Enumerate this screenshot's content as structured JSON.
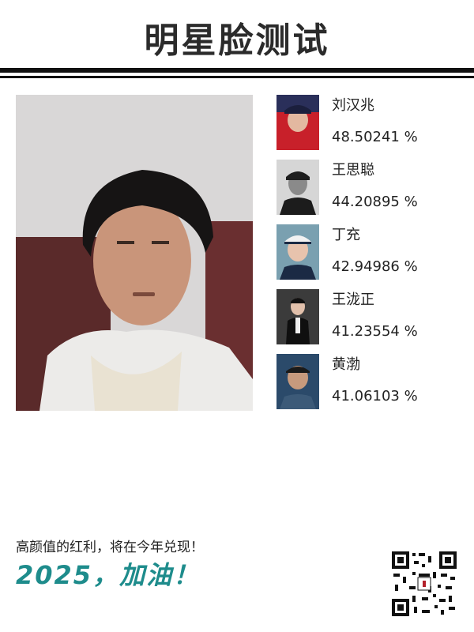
{
  "title": "明星脸测试",
  "results": [
    {
      "name": "刘汉兆",
      "score": "48.50241 %"
    },
    {
      "name": "王思聪",
      "score": "44.20895 %"
    },
    {
      "name": "丁充",
      "score": "42.94986 %"
    },
    {
      "name": "王泷正",
      "score": "41.23554 %"
    },
    {
      "name": "黄渤",
      "score": "41.06103 %"
    }
  ],
  "footer": {
    "slogan": "高颜值的红利，将在今年兑现！",
    "cheer": "2025，加油！"
  },
  "colors": {
    "accent": "#1e8c8c",
    "rule": "#111111",
    "text": "#222222"
  },
  "icons": {
    "qr": "qr-code-icon"
  }
}
